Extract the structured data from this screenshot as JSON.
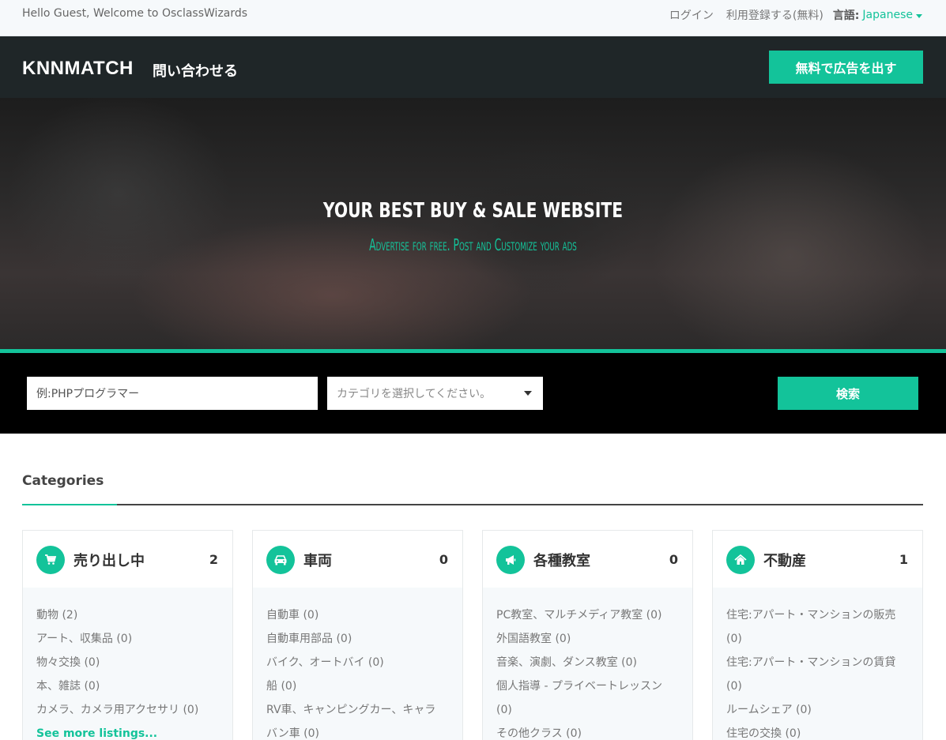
{
  "topbar": {
    "welcome": "Hello Guest, Welcome to OsclassWizards",
    "login": "ログイン",
    "register": "利用登録する(無料)",
    "language_label": "言語:",
    "language_value": "Japanese"
  },
  "header": {
    "brand": "KNNMATCH",
    "contact": "問い合わせる",
    "post_button": "無料で広告を出す"
  },
  "hero": {
    "title": "YOUR BEST BUY & SALE WEBSITE",
    "subtitle": "Advertise for free. Post and Customize your ads"
  },
  "search": {
    "placeholder": "例:PHPプログラマー",
    "category_placeholder": "カテゴリを選択してください。",
    "button": "検索"
  },
  "categories": {
    "heading": "Categories",
    "cards": [
      {
        "icon": "cart-icon",
        "title": "売り出し中",
        "count": "2",
        "items": [
          "動物 (2)",
          "アート、収集品 (0)",
          "物々交換 (0)",
          "本、雑誌 (0)",
          "カメラ、カメラ用アクセサリ (0)"
        ],
        "more": "See more listings..."
      },
      {
        "icon": "car-icon",
        "title": "車両",
        "count": "0",
        "items": [
          "自動車 (0)",
          "自動車用部品 (0)",
          "バイク、オートバイ (0)",
          "船 (0)",
          "RV車、キャンピングカー、キャラ",
          "バン車 (0)"
        ]
      },
      {
        "icon": "megaphone-icon",
        "title": "各種教室",
        "count": "0",
        "items": [
          "PC教室、マルチメディア教室 (0)",
          "外国語教室 (0)",
          "音楽、演劇、ダンス教室 (0)",
          "個人指導 - プライベートレッスン",
          "(0)",
          "その他クラス (0)"
        ]
      },
      {
        "icon": "home-icon",
        "title": "不動産",
        "count": "1",
        "items": [
          "住宅:アパート・マンションの販売",
          "(0)",
          "住宅:アパート・マンションの賃貸",
          "(0)",
          "ルームシェア (0)",
          "住宅の交換 (0)"
        ]
      }
    ]
  },
  "colors": {
    "accent": "#13c39a",
    "header_bg": "#1f2628",
    "search_bg": "#000000"
  }
}
